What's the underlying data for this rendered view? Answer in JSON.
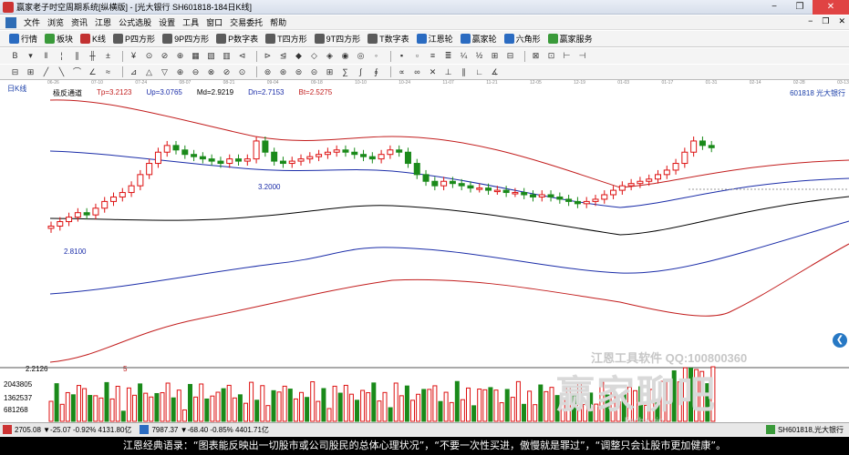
{
  "window": {
    "title": "赢家老子时空周期系统[纵横版] - [光大银行  SH601818-184日K线]",
    "min": "−",
    "restore": "❐",
    "close": "✕"
  },
  "menu": {
    "items": [
      "文件",
      "浏览",
      "资讯",
      "江恩",
      "公式选股",
      "设置",
      "工具",
      "窗口",
      "交易委托",
      "帮助"
    ],
    "right_controls": [
      "−",
      "❐",
      "✕"
    ]
  },
  "toolbar1": {
    "buttons": [
      {
        "label": "行情",
        "color": "#2a6bc1"
      },
      {
        "label": "板块",
        "color": "#3a9a3a"
      },
      {
        "label": "K线",
        "color": "#c23131"
      },
      {
        "label": "P四方形",
        "color": "#5b5b5b"
      },
      {
        "label": "9P四方形",
        "color": "#5b5b5b"
      },
      {
        "label": "P数字表",
        "color": "#5b5b5b"
      },
      {
        "label": "T四方形",
        "color": "#5b5b5b"
      },
      {
        "label": "9T四方形",
        "color": "#5b5b5b"
      },
      {
        "label": "T数字表",
        "color": "#5b5b5b"
      },
      {
        "label": "江恩轮",
        "color": "#2a6bc1"
      },
      {
        "label": "赢家轮",
        "color": "#2a6bc1"
      },
      {
        "label": "六角形",
        "color": "#2a6bc1"
      },
      {
        "label": "赢家服务",
        "color": "#3a9a3a"
      }
    ]
  },
  "chart_header": {
    "period": "日K线",
    "indicator_name": "极反通道",
    "tp": "Tp=3.2123",
    "up": "Up=3.0765",
    "md": "Md=2.9219",
    "dn": "Dn=2.7153",
    "bt": "Bt=2.5275",
    "stock": "601818 光大银行"
  },
  "date_ticks": [
    "06-26",
    "07-10",
    "07-24",
    "08-07",
    "08-21",
    "09-04",
    "09-18",
    "10-10",
    "10-24",
    "11-07",
    "11-21",
    "12-05",
    "12-19",
    "01-03",
    "01-17",
    "01-31",
    "02-14",
    "02-28",
    "03-13"
  ],
  "annotations": {
    "high": "3.2000",
    "low": "2.8100",
    "bottom_value": "2.2126",
    "bottom_marker": "5"
  },
  "volume_labels": [
    "2043805",
    "1362537",
    "681268"
  ],
  "watermark": {
    "line1": "江恩工具软件  QQ:100800360",
    "line2": "赢家聊吧",
    "line3": "liaoba.vip"
  },
  "statusbar": {
    "sh": "2705.08 ▼-25.07 -0.92% 4131.80亿",
    "sz": "7987.37 ▼-68.40 -0.85% 4401.71亿",
    "stock_tab": "SH601818,光大银行"
  },
  "caption": "江恩经典语录：“图表能反映出一切股市或公司股民的总体心理状况”，“不要一次性买进，傲慢就是罪过”，“调整只会让股市更加健康”。",
  "chart_data": {
    "type": "line",
    "candles_close": [
      2.82,
      2.84,
      2.86,
      2.88,
      2.87,
      2.9,
      2.93,
      2.95,
      2.97,
      3.0,
      3.05,
      3.1,
      3.15,
      3.18,
      3.16,
      3.14,
      3.13,
      3.12,
      3.11,
      3.1,
      3.12,
      3.11,
      3.12,
      3.2,
      3.15,
      3.11,
      3.1,
      3.11,
      3.12,
      3.13,
      3.14,
      3.15,
      3.16,
      3.15,
      3.14,
      3.13,
      3.12,
      3.14,
      3.16,
      3.15,
      3.1,
      3.05,
      3.02,
      3.0,
      3.02,
      3.01,
      3.0,
      2.99,
      2.99,
      2.98,
      2.98,
      2.97,
      2.97,
      2.96,
      2.95,
      2.96,
      2.95,
      2.94,
      2.93,
      2.92,
      2.93,
      2.94,
      2.96,
      2.98,
      3.0,
      3.01,
      3.02,
      3.03,
      3.05,
      3.07,
      3.1,
      3.15,
      3.2,
      3.18,
      3.17
    ],
    "ylim": [
      2.2126,
      3.35
    ]
  }
}
